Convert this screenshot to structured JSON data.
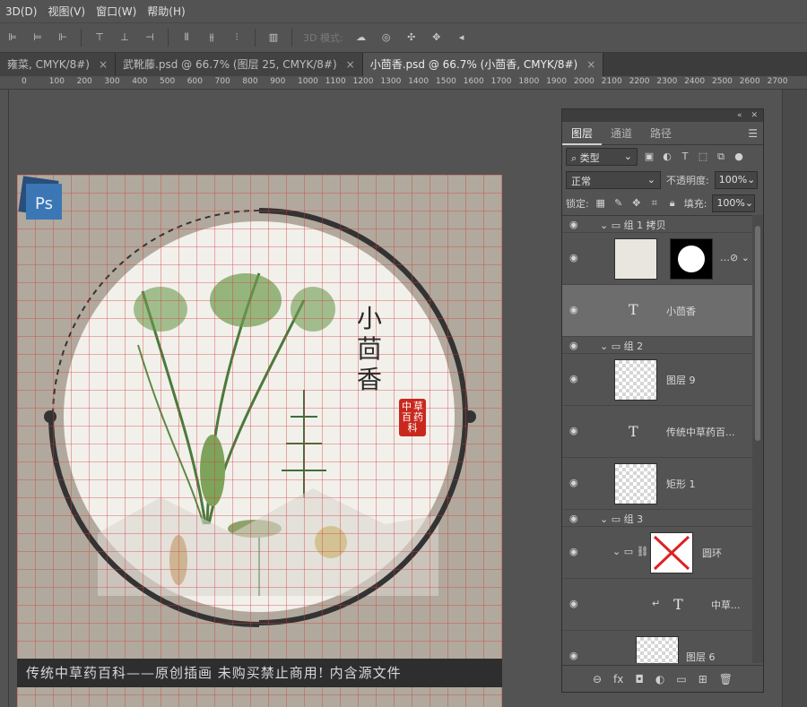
{
  "menu": [
    "3D(D)",
    "视图(V)",
    "窗口(W)",
    "帮助(H)"
  ],
  "options_bar": {
    "mode_label": "3D 模式:"
  },
  "tabs": [
    {
      "label": "雍菜, CMYK/8#)",
      "close": "×"
    },
    {
      "label": "武靴藤.psd @ 66.7% (图层 25, CMYK/8#)",
      "close": "×"
    },
    {
      "label": "小茴香.psd @ 66.7% (小茴香, CMYK/8#)",
      "close": "×"
    }
  ],
  "ruler": [
    "0",
    "100",
    "200",
    "300",
    "400",
    "500",
    "600",
    "700",
    "800",
    "900",
    "1000",
    "1100",
    "1200",
    "1300",
    "1400",
    "1500",
    "1600",
    "1700",
    "1800",
    "1900",
    "2000",
    "2100",
    "2200",
    "2300",
    "2400",
    "2500",
    "2600",
    "2700"
  ],
  "document": {
    "title_chars": [
      "小",
      "茴",
      "香"
    ],
    "seal_chars": [
      "中",
      "草",
      "百",
      "药",
      "科"
    ],
    "banner": "传统中草药百科——原创插画 未购买禁止商用! 内含源文件",
    "badge": "Ps"
  },
  "panel": {
    "tabs": [
      "图层",
      "通道",
      "路径"
    ],
    "filter_label": "类型",
    "blend_mode": "正常",
    "opacity_label": "不透明度:",
    "opacity": "100%",
    "lock_label": "锁定:",
    "fill_label": "填充:",
    "fill": "100%",
    "layers": [
      {
        "kind": "group",
        "name": "组 1 拷贝"
      },
      {
        "kind": "masked",
        "name": ""
      },
      {
        "kind": "text",
        "name": "小茴香",
        "selected": true
      },
      {
        "kind": "group",
        "name": "组 2"
      },
      {
        "kind": "image",
        "name": "图层 9"
      },
      {
        "kind": "text",
        "name": "传统中草药百..."
      },
      {
        "kind": "image",
        "name": "矩形 1"
      },
      {
        "kind": "group",
        "name": "组 3"
      },
      {
        "kind": "linked",
        "name": "圆环"
      },
      {
        "kind": "text",
        "name": "中草..."
      },
      {
        "kind": "image",
        "name": "图层 6"
      }
    ]
  },
  "colors": {
    "grid": "#d33b3b",
    "paper": "#b1a99d",
    "circle": "#f1efea",
    "ring": "#333333"
  }
}
